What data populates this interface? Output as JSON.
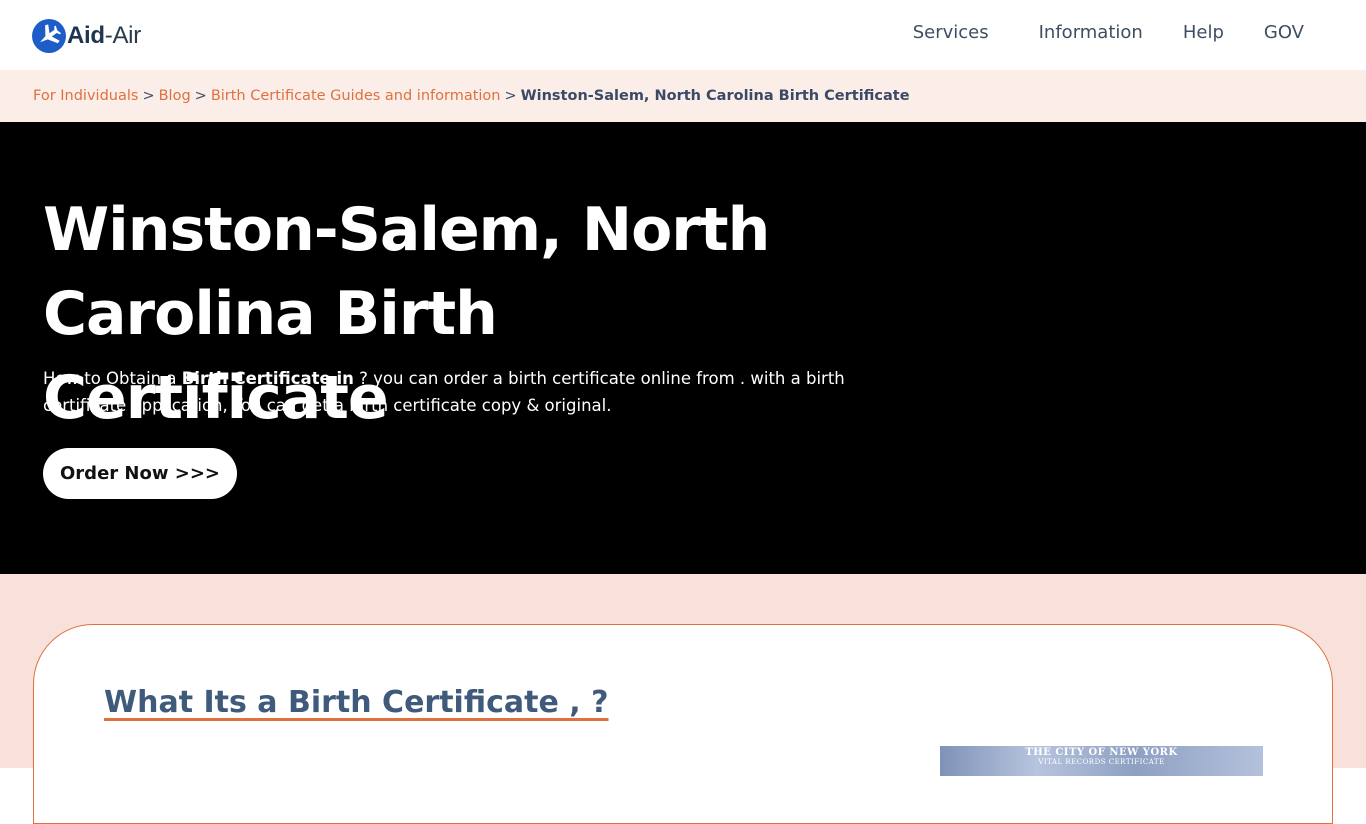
{
  "header": {
    "logo_bold": "Aid",
    "logo_rest": "-Air",
    "nav": [
      "Services",
      "Information",
      "Help",
      "GOV"
    ]
  },
  "breadcrumb": {
    "links": [
      "For Individuals",
      "Blog",
      "Birth Certificate Guides and information"
    ],
    "separator": ">",
    "current": "Winston-Salem, North Carolina Birth Certificate"
  },
  "hero": {
    "title": "Winston-Salem, North Carolina Birth Certificate",
    "desc_prefix": "How to Obtain a ",
    "desc_bold": "Birth Certificate in",
    "desc_suffix": " ? you can order a birth certificate online from . with a birth certificate application, You can get a birth certificate copy & original.",
    "button": "Order Now >>>"
  },
  "section": {
    "heading": "What Its a Birth Certificate , ?",
    "image_line1": "THE CITY OF NEW YORK",
    "image_line2": "VITAL RECORDS CERTIFICATE"
  },
  "colors": {
    "accent": "#e0703e",
    "nav_text": "#3d4e63",
    "breadcrumb_bg": "#fbeee9",
    "section_bg": "#f8e1db",
    "hero_bg": "#000000",
    "logo_blue": "#1e5cc8"
  },
  "icons": {
    "logo": "plane-globe-icon"
  }
}
